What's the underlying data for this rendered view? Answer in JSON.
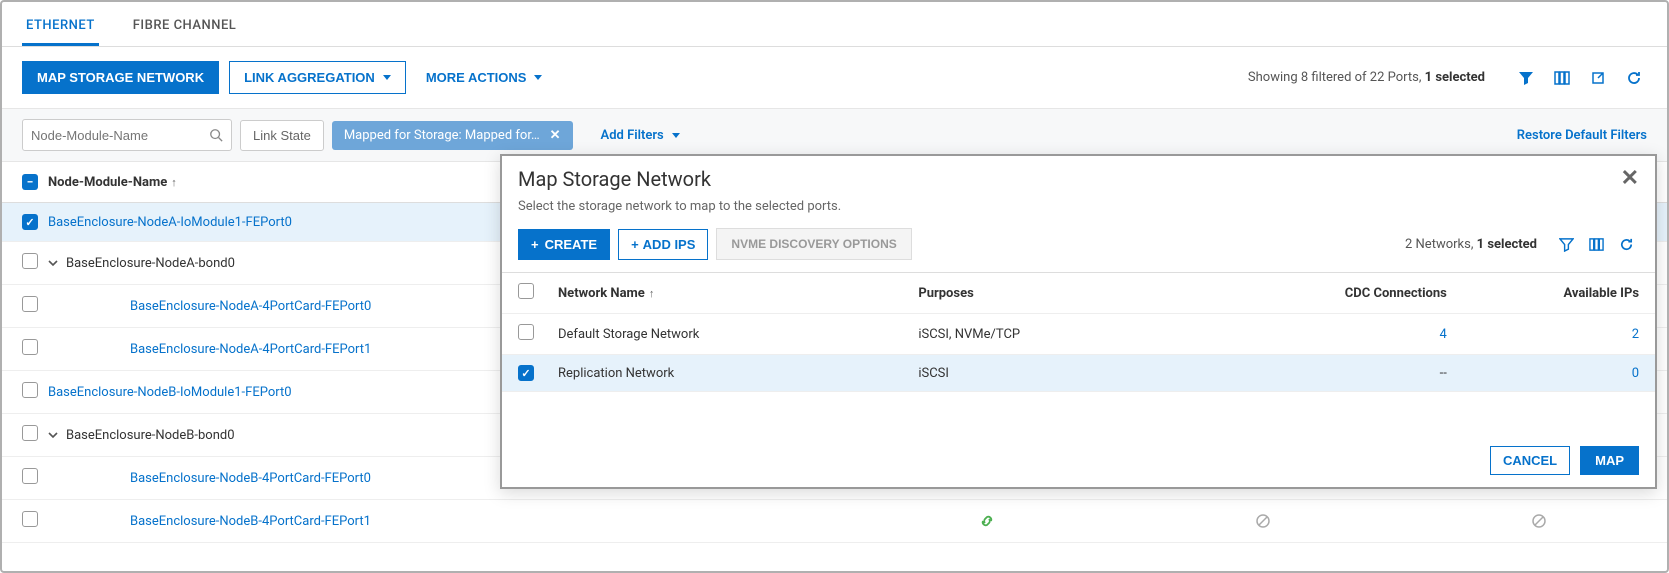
{
  "tabs": {
    "ethernet": "ETHERNET",
    "fibre": "FIBRE CHANNEL"
  },
  "toolbar": {
    "map_storage_network": "MAP STORAGE NETWORK",
    "link_aggregation": "LINK AGGREGATION",
    "more_actions": "MORE ACTIONS",
    "status_prefix": "Showing 8 filtered of 22 Ports, ",
    "status_bold": "1 selected"
  },
  "filters": {
    "search_placeholder": "Node-Module-Name",
    "link_state": "Link State",
    "mapped_chip": "Mapped for Storage: Mapped for…",
    "add_filters": "Add Filters",
    "restore": "Restore Default Filters"
  },
  "tree": {
    "header": "Node-Module-Name",
    "rows": [
      {
        "label": "BaseEnclosure-NodeA-IoModule1-FEPort0",
        "link": true,
        "checked": true,
        "expandable": false,
        "indent": 0
      },
      {
        "label": "BaseEnclosure-NodeA-bond0",
        "link": false,
        "checked": false,
        "expandable": true,
        "indent": 0
      },
      {
        "label": "BaseEnclosure-NodeA-4PortCard-FEPort0",
        "link": true,
        "checked": false,
        "expandable": false,
        "indent": 2
      },
      {
        "label": "BaseEnclosure-NodeA-4PortCard-FEPort1",
        "link": true,
        "checked": false,
        "expandable": false,
        "indent": 2
      },
      {
        "label": "BaseEnclosure-NodeB-IoModule1-FEPort0",
        "link": true,
        "checked": false,
        "expandable": false,
        "indent": 0
      },
      {
        "label": "BaseEnclosure-NodeB-bond0",
        "link": false,
        "checked": false,
        "expandable": true,
        "indent": 0
      },
      {
        "label": "BaseEnclosure-NodeB-4PortCard-FEPort0",
        "link": true,
        "checked": false,
        "expandable": false,
        "indent": 2
      },
      {
        "label": "BaseEnclosure-NodeB-4PortCard-FEPort1",
        "link": true,
        "checked": false,
        "expandable": false,
        "indent": 2
      }
    ]
  },
  "modal": {
    "title": "Map Storage Network",
    "subtitle": "Select the storage network to map to the selected ports.",
    "create": "CREATE",
    "add_ips": "ADD IPS",
    "nvme": "NVME DISCOVERY OPTIONS",
    "status_prefix": "2 Networks, ",
    "status_bold": "1 selected",
    "cols": {
      "name": "Network Name",
      "purposes": "Purposes",
      "cdc": "CDC Connections",
      "ips": "Available IPs"
    },
    "rows": [
      {
        "name": "Default Storage Network",
        "purposes": "iSCSI, NVMe/TCP",
        "cdc": "4",
        "ips": "2",
        "checked": false
      },
      {
        "name": "Replication Network",
        "purposes": "iSCSI",
        "cdc": "--",
        "ips": "0",
        "checked": true
      }
    ],
    "cancel": "CANCEL",
    "map": "MAP"
  }
}
